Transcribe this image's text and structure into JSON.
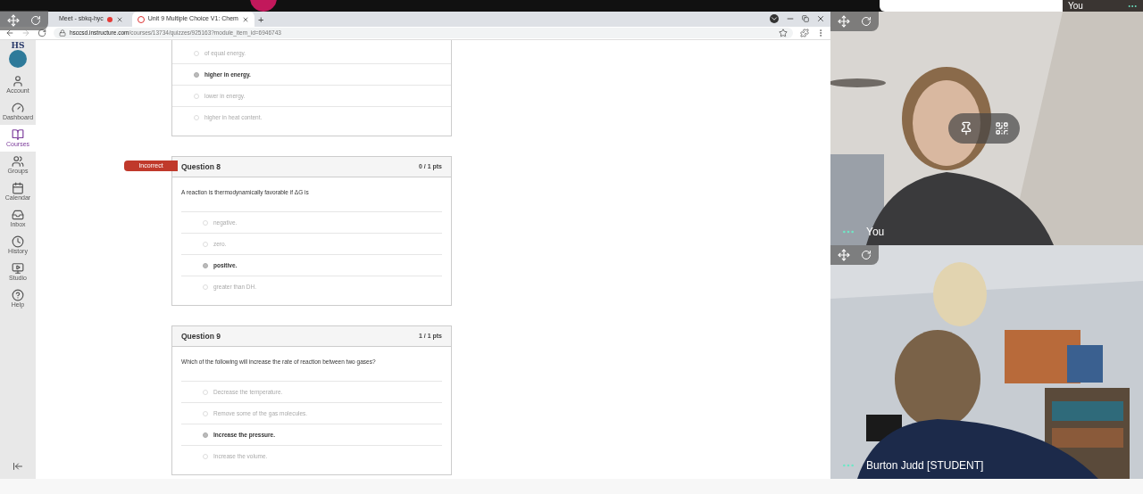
{
  "meet_bar": {
    "self_label": "You"
  },
  "browser": {
    "tabs": [
      {
        "title": "Meet - sbkq-hyc",
        "selected": false,
        "recording": true
      },
      {
        "title": "Unit 9 Multiple Choice V1: Chem",
        "selected": true,
        "recording": false
      }
    ],
    "new_tab": "+",
    "url_host": "hsccsd.instructure.com",
    "url_path": "/courses/13734/quizzes/925163?module_item_id=6946743"
  },
  "sidebar": {
    "logo": "HS",
    "items": [
      {
        "label": "Account",
        "selected": false
      },
      {
        "label": "Dashboard",
        "selected": false
      },
      {
        "label": "Courses",
        "selected": true
      },
      {
        "label": "Groups",
        "selected": false
      },
      {
        "label": "Calendar",
        "selected": false
      },
      {
        "label": "Inbox",
        "selected": false
      },
      {
        "label": "History",
        "selected": false
      },
      {
        "label": "Studio",
        "selected": false
      },
      {
        "label": "Help",
        "selected": false
      }
    ]
  },
  "quiz": {
    "partial_options": [
      {
        "text": "of equal energy.",
        "selected": false
      },
      {
        "text": "higher in energy.",
        "selected": true
      },
      {
        "text": "lower in energy.",
        "selected": false
      },
      {
        "text": "higher in heat content.",
        "selected": false
      }
    ],
    "questions": [
      {
        "title": "Question 8",
        "points": "0 / 1 pts",
        "status": "Incorrect",
        "text": "A reaction is thermodynamically favorable if ΔG is",
        "options": [
          {
            "text": "negative.",
            "selected": false
          },
          {
            "text": "zero.",
            "selected": false
          },
          {
            "text": "positive.",
            "selected": true
          },
          {
            "text": "greater than DH.",
            "selected": false
          }
        ]
      },
      {
        "title": "Question 9",
        "points": "1 / 1 pts",
        "text": "Which of the following will increase the rate of reaction between two gases?",
        "options": [
          {
            "text": "Decrease the temperature.",
            "selected": false
          },
          {
            "text": "Remove some of the gas molecules.",
            "selected": false
          },
          {
            "text": "Increase the pressure.",
            "selected": true
          },
          {
            "text": "Increase the volume.",
            "selected": false
          }
        ]
      }
    ]
  },
  "participants": [
    {
      "name": "You"
    },
    {
      "name": "Burton Judd [STUDENT]"
    }
  ]
}
